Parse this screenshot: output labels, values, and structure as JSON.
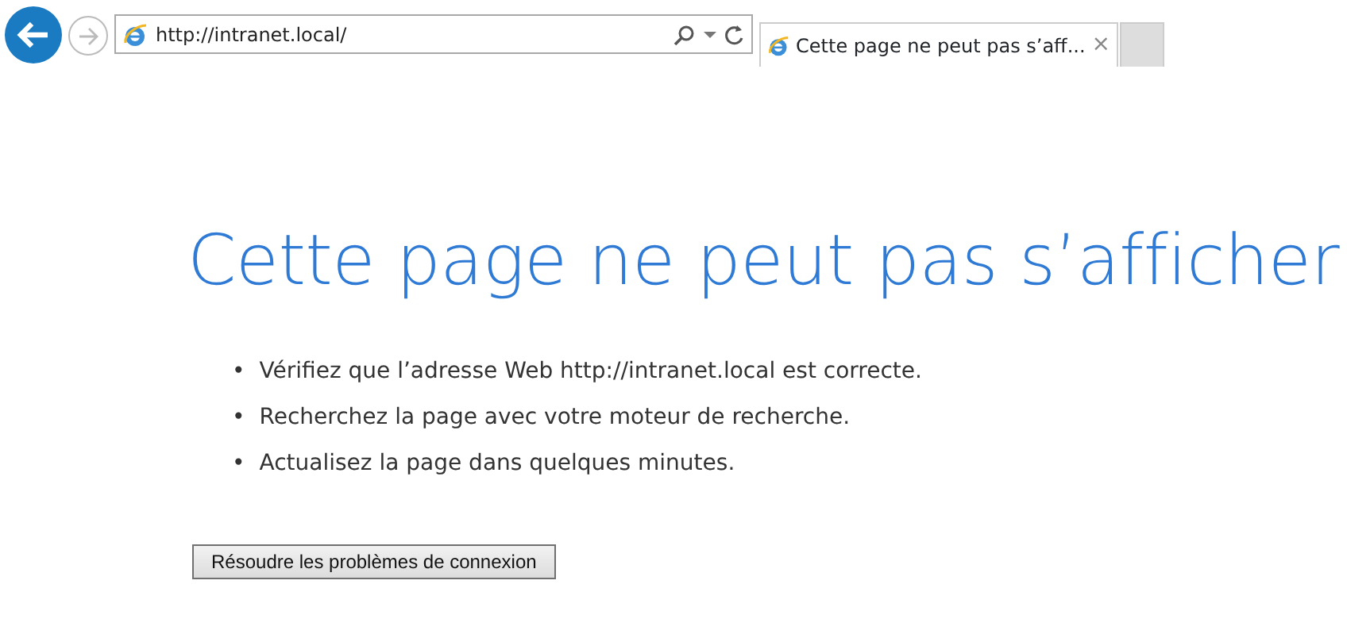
{
  "toolbar": {
    "address": {
      "value": "http://intranet.local/"
    }
  },
  "tabs": [
    {
      "label": "Cette page ne peut pas s’aff...",
      "close": "×",
      "selected": true
    }
  ],
  "page": {
    "heading": "Cette page ne peut pas s’afficher",
    "suggestions": [
      {
        "bullet": "•",
        "text": "Vérifiez que l’adresse Web http://intranet.local est correcte."
      },
      {
        "bullet": "•",
        "text": "Recherchez la page avec votre moteur de recherche."
      },
      {
        "bullet": "•",
        "text": "Actualisez la page dans quelques minutes."
      }
    ],
    "button": "Résoudre les problèmes de connexion"
  }
}
